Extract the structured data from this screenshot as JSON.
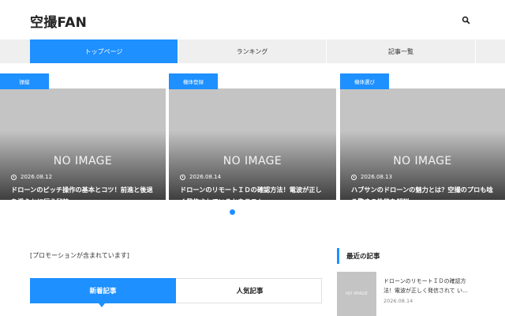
{
  "header": {
    "site_title": "空撮FAN",
    "search_icon": "search-icon"
  },
  "nav": {
    "items": [
      {
        "label": "トップページ",
        "active": true
      },
      {
        "label": "ランキング",
        "active": false
      },
      {
        "label": "記事一覧",
        "active": false
      }
    ]
  },
  "slider": {
    "no_image_text": "NO IMAGE",
    "cards": [
      {
        "category": "操縦",
        "date": "2026.08.12",
        "title": "ドローンのピッチ操作の基本とコツ！前進と後退を滑らかに行う秘訣"
      },
      {
        "category": "機体登録",
        "date": "2026.08.14",
        "title": "ドローンのリモートＩＤの確認方法！電波が正しく発信されているかをテスト"
      },
      {
        "category": "機体選び",
        "date": "2026.08.13",
        "title": "ハブサンのドローンの魅力とは？空撮のプロも唸る驚きの性能を解説"
      }
    ]
  },
  "main": {
    "promo_text": "[プロモーションが含まれています]",
    "tabs": [
      {
        "label": "新着記事",
        "active": true
      },
      {
        "label": "人気記事",
        "active": false
      }
    ]
  },
  "sidebar": {
    "heading": "最近の記事",
    "posts": [
      {
        "thumb_text": "NO IMAGE",
        "title": "ドローンのリモートＩＤの確認方法！電波が正しく発信されて い…",
        "date": "2026.08.14"
      }
    ]
  },
  "colors": {
    "accent": "#1e90ff",
    "nav_bg": "#efefef",
    "placeholder": "#c4c4c4"
  }
}
